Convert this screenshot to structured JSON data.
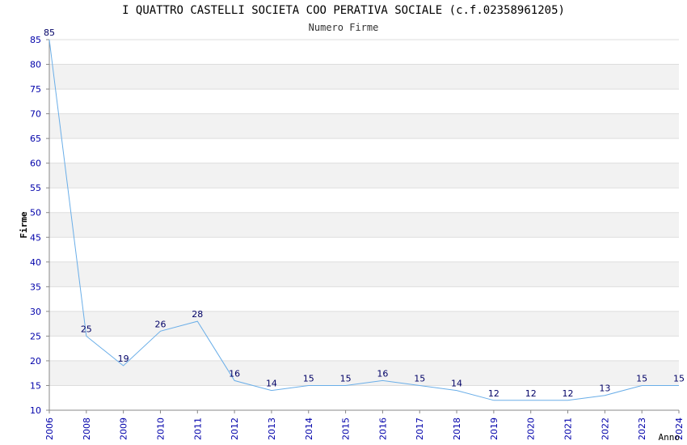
{
  "header": {
    "title": "I QUATTRO CASTELLI SOCIETA COO PERATIVA SOCIALE (c.f.02358961205)",
    "subtitle": "Numero Firme"
  },
  "chart_data": {
    "type": "line",
    "title": "I QUATTRO CASTELLI SOCIETA COO PERATIVA SOCIALE (c.f.02358961205)",
    "subtitle": "Numero Firme",
    "xlabel": "Anno",
    "ylabel": "Firme",
    "x": [
      "2006",
      "2008",
      "2009",
      "2010",
      "2011",
      "2012",
      "2013",
      "2014",
      "2015",
      "2016",
      "2017",
      "2018",
      "2019",
      "2020",
      "2021",
      "2022",
      "2023",
      "2024"
    ],
    "values": [
      85,
      25,
      19,
      26,
      28,
      16,
      14,
      15,
      15,
      16,
      15,
      14,
      12,
      12,
      12,
      13,
      15,
      15
    ],
    "ylim": [
      10,
      85
    ],
    "yticks": [
      10,
      15,
      20,
      25,
      30,
      35,
      40,
      45,
      50,
      55,
      60,
      65,
      70,
      75,
      80,
      85
    ],
    "grid": true,
    "line_color": "#6aaee8",
    "band_color": "#f2f2f2",
    "tick_color": "#0000aa",
    "label_color": "#000066"
  }
}
